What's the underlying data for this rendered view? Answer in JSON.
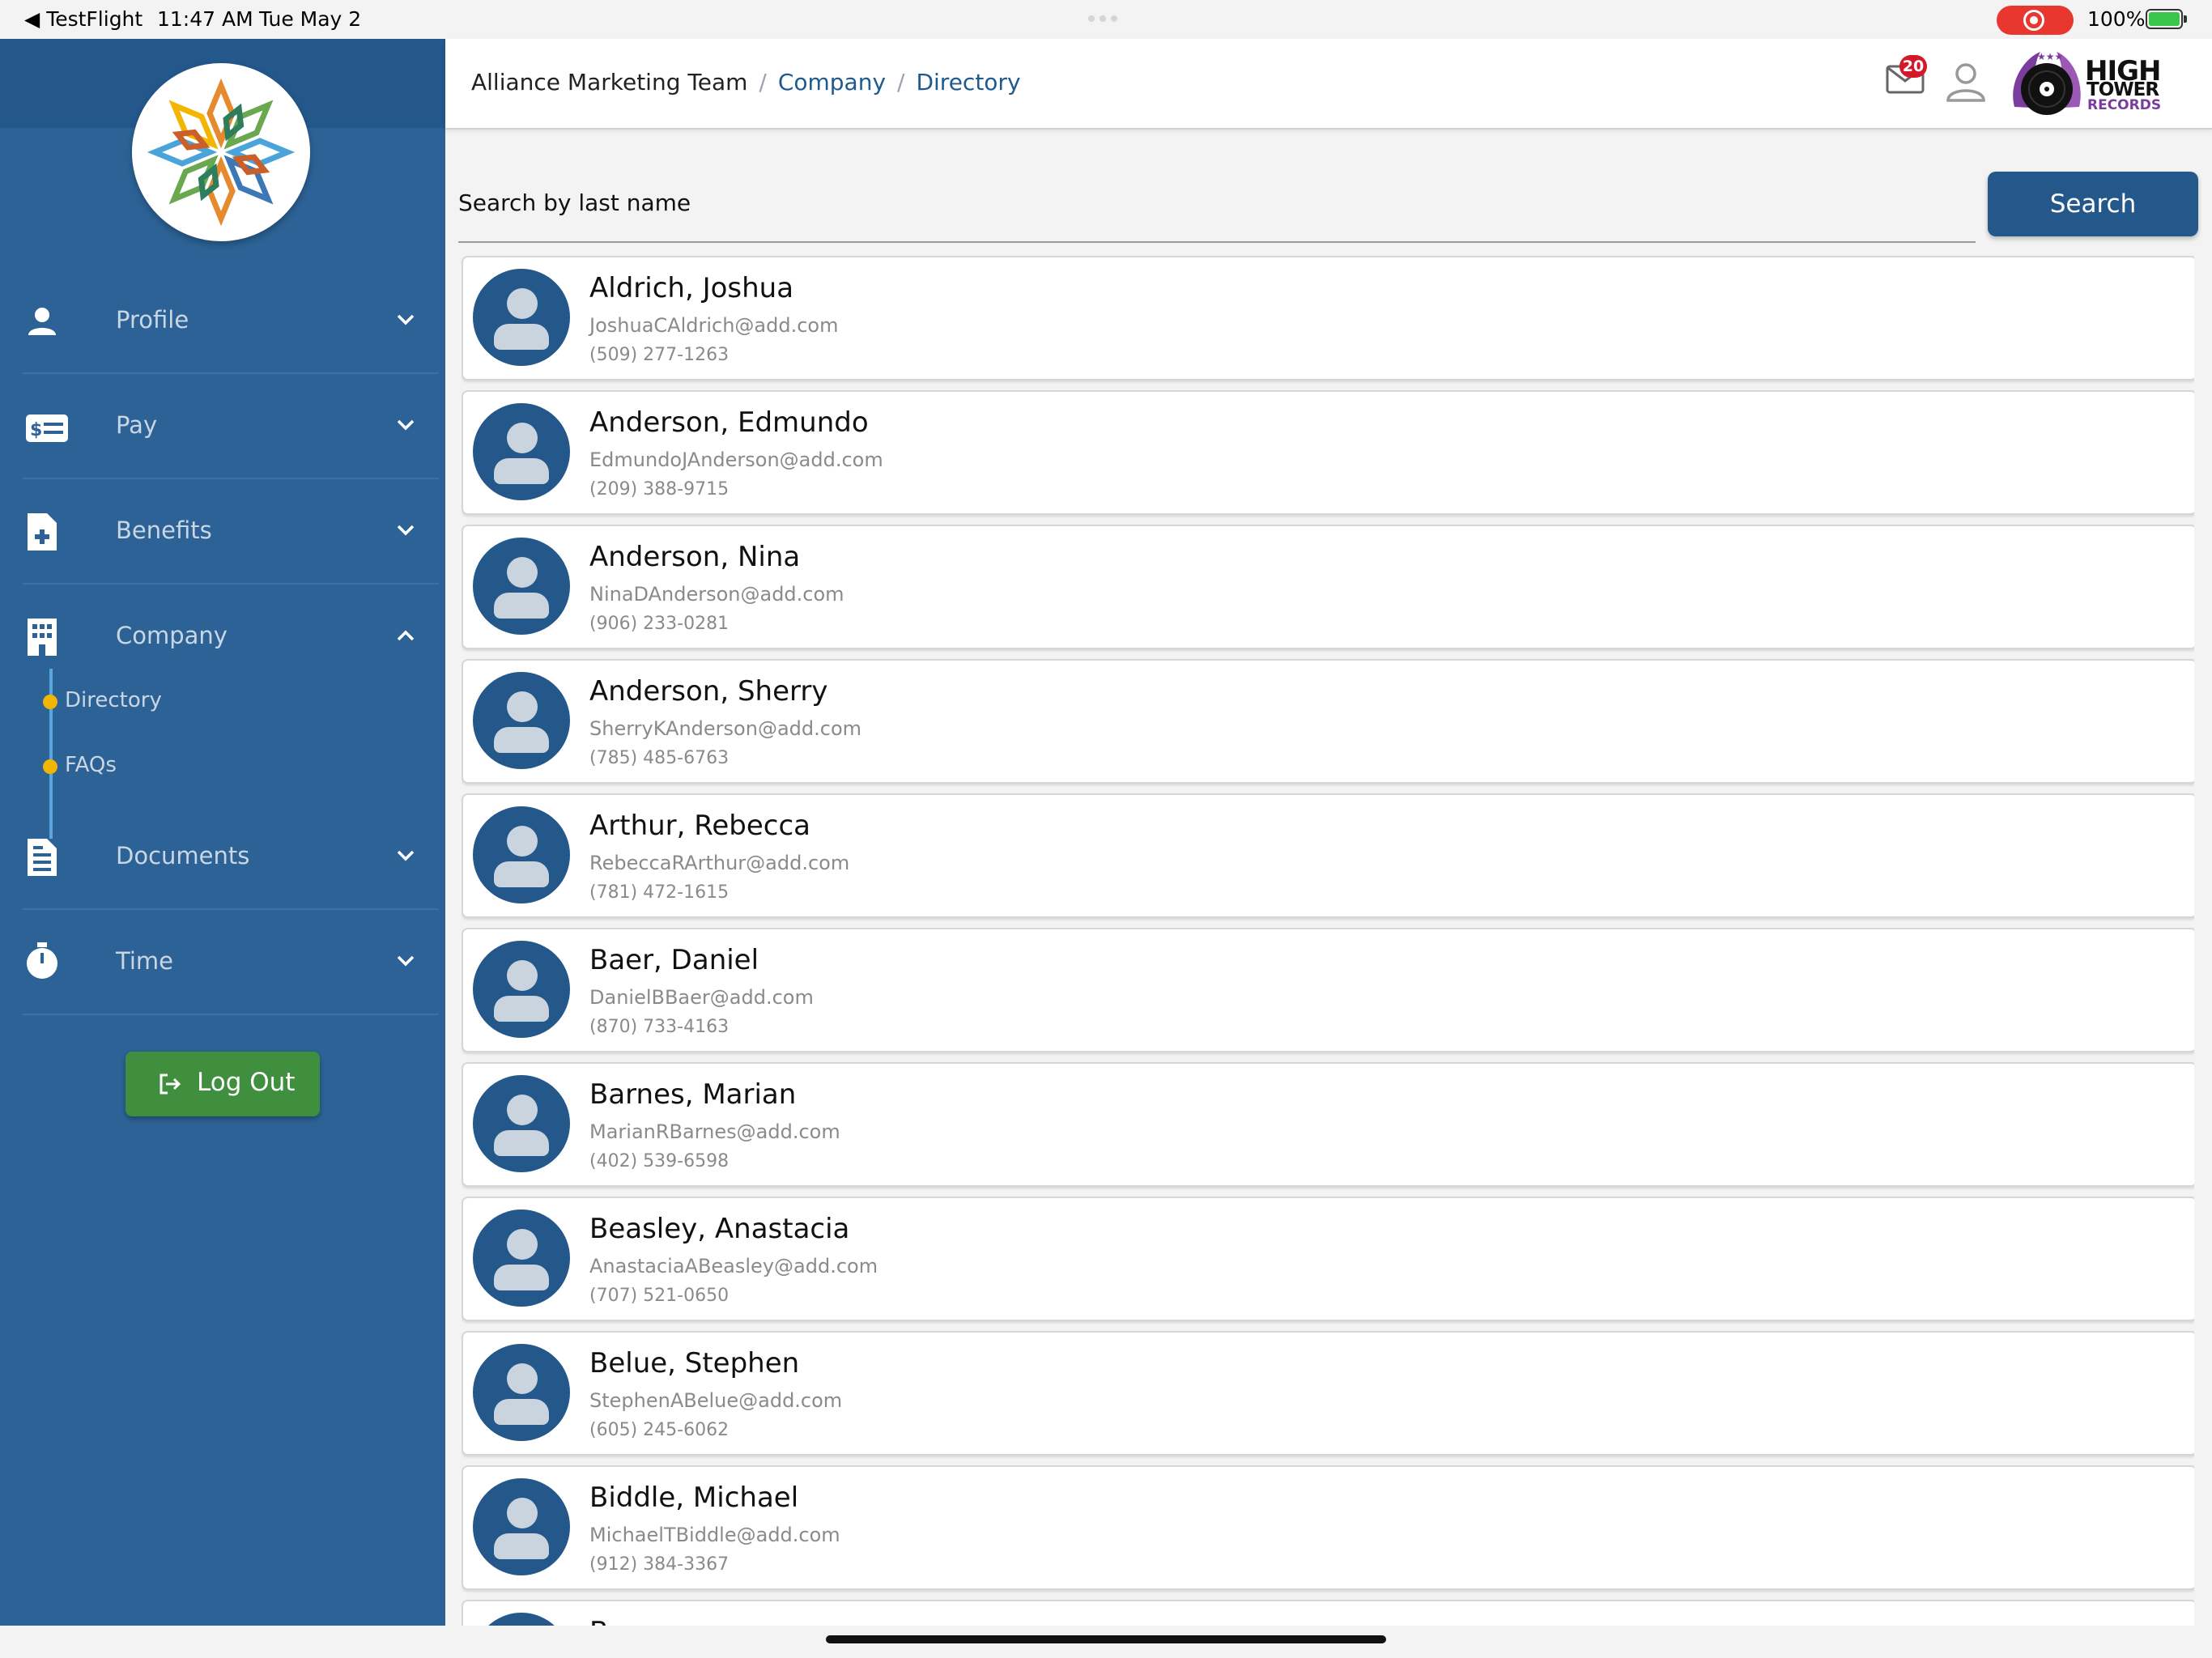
{
  "status_bar": {
    "back_app": "TestFlight",
    "time": "11:47 AM",
    "date": "Tue May 2",
    "battery": "100%"
  },
  "sidebar": {
    "items": [
      {
        "label": "Profile",
        "icon": "person-icon",
        "expanded": false
      },
      {
        "label": "Pay",
        "icon": "pay-card-icon",
        "expanded": false
      },
      {
        "label": "Benefits",
        "icon": "medical-document-icon",
        "expanded": false
      },
      {
        "label": "Company",
        "icon": "building-icon",
        "expanded": true
      },
      {
        "label": "Documents",
        "icon": "document-icon",
        "expanded": false
      },
      {
        "label": "Time",
        "icon": "stopwatch-icon",
        "expanded": false
      }
    ],
    "company_subitems": [
      "Directory",
      "FAQs"
    ],
    "logout_label": "Log Out"
  },
  "header": {
    "breadcrumb": [
      "Alliance Marketing Team",
      "Company",
      "Directory"
    ],
    "mail_badge": "20",
    "brand_logo": [
      "HIGH",
      "TOWER",
      "RECORDS"
    ]
  },
  "search": {
    "placeholder": "Search by last name",
    "button_label": "Search"
  },
  "directory": [
    {
      "name": "Aldrich, Joshua",
      "email": "JoshuaCAldrich@add.com",
      "phone": "(509) 277-1263"
    },
    {
      "name": "Anderson, Edmundo",
      "email": "EdmundoJAnderson@add.com",
      "phone": "(209) 388-9715"
    },
    {
      "name": "Anderson, Nina",
      "email": "NinaDAnderson@add.com",
      "phone": "(906) 233-0281"
    },
    {
      "name": "Anderson, Sherry",
      "email": "SherryKAnderson@add.com",
      "phone": "(785) 485-6763"
    },
    {
      "name": "Arthur, Rebecca",
      "email": "RebeccaRArthur@add.com",
      "phone": "(781) 472-1615"
    },
    {
      "name": "Baer, Daniel",
      "email": "DanielBBaer@add.com",
      "phone": "(870) 733-4163"
    },
    {
      "name": "Barnes, Marian",
      "email": "MarianRBarnes@add.com",
      "phone": "(402) 539-6598"
    },
    {
      "name": "Beasley, Anastacia",
      "email": "AnastaciaABeasley@add.com",
      "phone": "(707) 521-0650"
    },
    {
      "name": "Belue, Stephen",
      "email": "StephenABelue@add.com",
      "phone": "(605) 245-6062"
    },
    {
      "name": "Biddle, Michael",
      "email": "MichaelTBiddle@add.com",
      "phone": "(912) 384-3367"
    },
    {
      "name": "B...",
      "email": "",
      "phone": ""
    }
  ],
  "colors": {
    "sidebar": "#2c6295",
    "primary": "#24578a",
    "logout": "#3f8f3f",
    "badge": "#d4182a",
    "subnav_dot": "#f2b600"
  }
}
